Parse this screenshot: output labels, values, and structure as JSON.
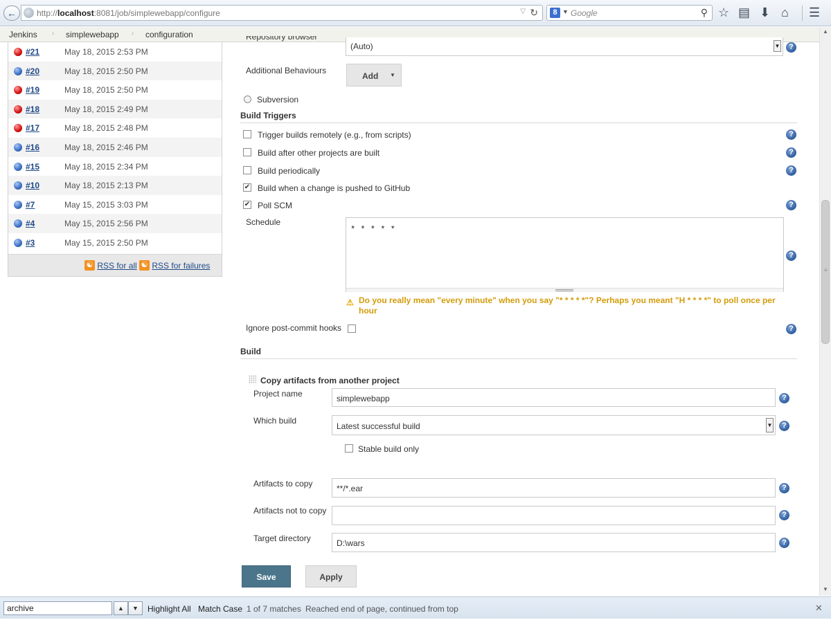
{
  "browser": {
    "url_host": "http://",
    "url_bold": "localhost",
    "url_rest": ":8081/job/simplewebapp/configure",
    "search_placeholder": "Google",
    "search_engine_letter": "8"
  },
  "breadcrumb": [
    "Jenkins",
    "simplewebapp",
    "configuration"
  ],
  "history": {
    "builds": [
      {
        "num": "#21",
        "date": "May 18, 2015 2:53 PM",
        "status": "red"
      },
      {
        "num": "#20",
        "date": "May 18, 2015 2:50 PM",
        "status": "blue"
      },
      {
        "num": "#19",
        "date": "May 18, 2015 2:50 PM",
        "status": "red"
      },
      {
        "num": "#18",
        "date": "May 18, 2015 2:49 PM",
        "status": "red"
      },
      {
        "num": "#17",
        "date": "May 18, 2015 2:48 PM",
        "status": "red"
      },
      {
        "num": "#16",
        "date": "May 18, 2015 2:46 PM",
        "status": "blue"
      },
      {
        "num": "#15",
        "date": "May 18, 2015 2:34 PM",
        "status": "blue"
      },
      {
        "num": "#10",
        "date": "May 18, 2015 2:13 PM",
        "status": "blue"
      },
      {
        "num": "#7",
        "date": "May 15, 2015 3:03 PM",
        "status": "blue"
      },
      {
        "num": "#4",
        "date": "May 15, 2015 2:56 PM",
        "status": "blue"
      },
      {
        "num": "#3",
        "date": "May 15, 2015 2:50 PM",
        "status": "blue"
      }
    ],
    "rss_all": "RSS for all",
    "rss_failures": "RSS for failures"
  },
  "scm": {
    "repo_browser_label": "Repository browser",
    "repo_browser_value": "(Auto)",
    "additional_behaviours_label": "Additional Behaviours",
    "add_button": "Add",
    "subversion_label": "Subversion"
  },
  "build_triggers": {
    "title": "Build Triggers",
    "options": [
      {
        "label": "Trigger builds remotely (e.g., from scripts)",
        "checked": false
      },
      {
        "label": "Build after other projects are built",
        "checked": false
      },
      {
        "label": "Build periodically",
        "checked": false
      },
      {
        "label": "Build when a change is pushed to GitHub",
        "checked": true
      },
      {
        "label": "Poll SCM",
        "checked": true
      }
    ],
    "schedule_label": "Schedule",
    "schedule_value": "* * * * *",
    "warning": "Do you really mean \"every minute\" when you say \"* * * * *\"? Perhaps you meant \"H * * * *\" to poll once per hour",
    "ignore_hooks_label": "Ignore post-commit hooks"
  },
  "build": {
    "title": "Build",
    "step_title": "Copy artifacts from another project",
    "project_name_label": "Project name",
    "project_name_value": "simplewebapp",
    "which_build_label": "Which build",
    "which_build_value": "Latest successful build",
    "stable_only_label": "Stable build only",
    "artifacts_label": "Artifacts to copy",
    "artifacts_value": "**/*.ear",
    "artifacts_not_label": "Artifacts not to copy",
    "artifacts_not_value": "",
    "target_dir_label": "Target directory",
    "target_dir_value": "D:\\wars"
  },
  "actions": {
    "save": "Save",
    "apply": "Apply"
  },
  "findbar": {
    "query": "archive",
    "highlight_all": "Highlight All",
    "match_case": "Match Case",
    "matches": "1 of 7 matches",
    "status": "Reached end of page, continued from top"
  },
  "colors": {
    "accent": "#4b758b",
    "link": "#204a87",
    "warning": "#d39c0b",
    "failed": "#d41111",
    "success": "#3a6fc4"
  }
}
